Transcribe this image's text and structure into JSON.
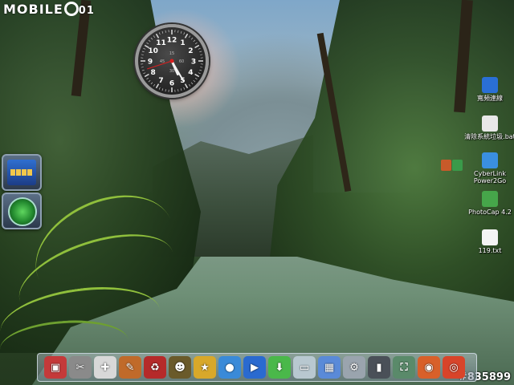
{
  "watermark": {
    "logo_text": "MOBILE",
    "logo_suffix": "01",
    "image_id": "#835899"
  },
  "clock": {
    "numbers": [
      "12",
      "1",
      "2",
      "3",
      "4",
      "5",
      "6",
      "7",
      "8",
      "9",
      "10",
      "11"
    ],
    "sub_dial_labels": [
      "15",
      "45",
      "30",
      "60"
    ],
    "hands": {
      "hour": 5.2,
      "minute": 25,
      "second": 42
    },
    "face_color": "#262626",
    "accent_color": "#d92020"
  },
  "desktop_icons": [
    {
      "name": "broadband-icon",
      "label": "寬頻連線",
      "color": "#2a6fd6"
    },
    {
      "name": "batch-file-icon",
      "label": "清除系統垃圾.bat",
      "color": "#e8e8e8"
    },
    {
      "name": "power2go-icon",
      "label": "CyberLink Power2Go",
      "color": "#3a8fe0"
    },
    {
      "name": "photocap-icon",
      "label": "PhotoCap 4.2",
      "color": "#46a64a"
    },
    {
      "name": "text-file-icon",
      "label": "119.txt",
      "color": "#f4f4f4"
    }
  ],
  "dock": {
    "items": [
      {
        "name": "red-app-icon",
        "glyph": "▣",
        "color": "#c43a3a"
      },
      {
        "name": "tools-icon",
        "glyph": "✂",
        "color": "#8a8a8a"
      },
      {
        "name": "first-aid-icon",
        "glyph": "✚",
        "color": "#d8d8d8"
      },
      {
        "name": "paint-brush-icon",
        "glyph": "✎",
        "color": "#c06a2a"
      },
      {
        "name": "recycle-bin-icon",
        "glyph": "♻",
        "color": "#b52a2a"
      },
      {
        "name": "mask-icon",
        "glyph": "☻",
        "color": "#6a5a2a"
      },
      {
        "name": "game-gold-icon",
        "glyph": "★",
        "color": "#d8a82a"
      },
      {
        "name": "water-drop-icon",
        "glyph": "●",
        "color": "#3a8ad8"
      },
      {
        "name": "media-player-icon",
        "glyph": "▶",
        "color": "#2a6ad0"
      },
      {
        "name": "download-icon",
        "glyph": "⬇",
        "color": "#4ab84a"
      },
      {
        "name": "drive-icon",
        "glyph": "▭",
        "color": "#b8c8d0"
      },
      {
        "name": "picture-viewer-icon",
        "glyph": "▦",
        "color": "#5a8ad8"
      },
      {
        "name": "settings-icon",
        "glyph": "⚙",
        "color": "#9aa4ae"
      },
      {
        "name": "computer-tower-icon",
        "glyph": "▮",
        "color": "#4a5058"
      },
      {
        "name": "network-icon",
        "glyph": "⛶",
        "color": "#5a8a6a"
      },
      {
        "name": "firefox-icon",
        "glyph": "◉",
        "color": "#d8602a"
      },
      {
        "name": "chrome-icon",
        "glyph": "◎",
        "color": "#d8442a"
      }
    ]
  }
}
